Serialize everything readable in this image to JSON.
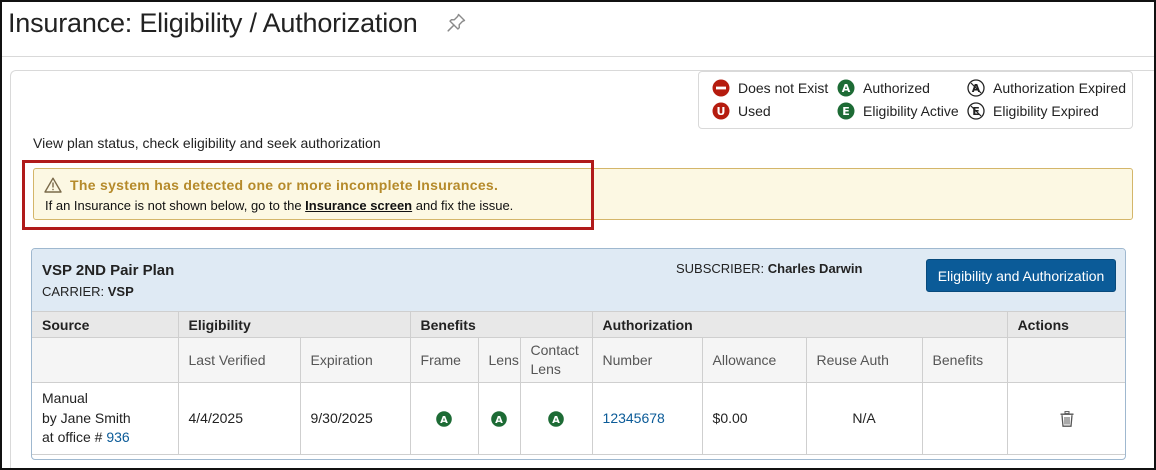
{
  "page": {
    "title": "Insurance: Eligibility / Authorization",
    "subtitle": "View plan status, check eligibility and seek authorization"
  },
  "legend": {
    "does_not_exist": "Does not Exist",
    "used": "Used",
    "authorized": "Authorized",
    "eligibility_active": "Eligibility Active",
    "authorization_expired": "Authorization Expired",
    "eligibility_expired": "Eligibility Expired"
  },
  "alert": {
    "title": "The system has detected one or more incomplete Insurances.",
    "text_before": "If an Insurance is not shown below, go to the ",
    "link": "Insurance screen",
    "text_after": " and fix the issue."
  },
  "plan": {
    "name": "VSP 2ND Pair Plan",
    "carrier_label": "CARRIER: ",
    "carrier": "VSP",
    "subscriber_label": "SUBSCRIBER: ",
    "subscriber": "Charles Darwin",
    "button": "Eligibility and Authorization"
  },
  "table": {
    "groups": {
      "source": "Source",
      "eligibility": "Eligibility",
      "benefits": "Benefits",
      "authorization": "Authorization",
      "actions": "Actions"
    },
    "columns": {
      "last_verified": "Last Verified",
      "expiration": "Expiration",
      "frame": "Frame",
      "lens": "Lens",
      "contact_lens": "Contact Lens",
      "number": "Number",
      "allowance": "Allowance",
      "reuse_auth": "Reuse Auth",
      "benefits": "Benefits"
    },
    "row": {
      "source_line1": "Manual",
      "source_line2": "by Jane Smith",
      "source_line3": "at office # ",
      "office": "936",
      "last_verified": "4/4/2025",
      "expiration": "9/30/2025",
      "frame_status": "A",
      "lens_status": "A",
      "contact_status": "A",
      "auth_number": "12345678",
      "allowance": "$0.00",
      "reuse_auth": "N/A",
      "benefits": ""
    }
  },
  "icons": {
    "badge_letters": {
      "used": "U",
      "authorized": "A",
      "eligibility_active": "E",
      "authorization_expired": "A",
      "eligibility_expired": "E"
    }
  },
  "colors": {
    "danger": "#b51c0f",
    "success": "#1d6b35",
    "primary": "#0b5b98",
    "warning_text": "#b58a2a",
    "warning_bg": "#fcf8e3",
    "highlight": "#b01a1a"
  }
}
